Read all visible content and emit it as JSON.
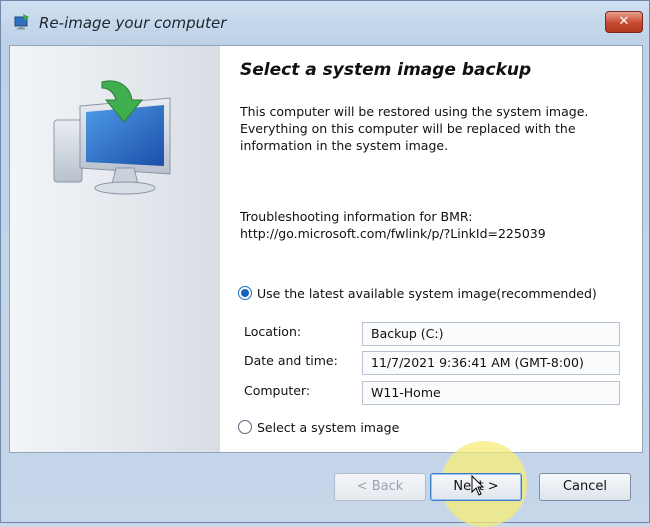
{
  "window": {
    "title": "Re-image your computer",
    "close_glyph": "✕"
  },
  "page": {
    "heading": "Select a system image backup",
    "description": "This computer will be restored using the system image. Everything on this computer will be replaced with the information in the system image.",
    "troubleshooting_line1": "Troubleshooting information for BMR:",
    "troubleshooting_line2": "http://go.microsoft.com/fwlink/p/?LinkId=225039"
  },
  "options": {
    "latest": {
      "label": "Use the latest available system image(recommended)",
      "checked": true
    },
    "select": {
      "label": "Select a system image",
      "checked": false
    }
  },
  "details": {
    "location_label": "Location:",
    "location_value": "Backup (C:)",
    "datetime_label": "Date and time:",
    "datetime_value": "11/7/2021 9:36:41 AM (GMT-8:00)",
    "computer_label": "Computer:",
    "computer_value": "W11-Home"
  },
  "buttons": {
    "back": "< Back",
    "next": "Next >",
    "cancel": "Cancel"
  },
  "icons": {
    "title": "restore-computer-icon",
    "side": "monitor-with-green-arrow-icon",
    "close": "close-icon",
    "cursor": "mouse-pointer-icon"
  },
  "colors": {
    "accent": "#1565c0",
    "title_bar": "#bdd1e7",
    "close_button": "#c74a32",
    "highlight": "#f6ec78"
  }
}
